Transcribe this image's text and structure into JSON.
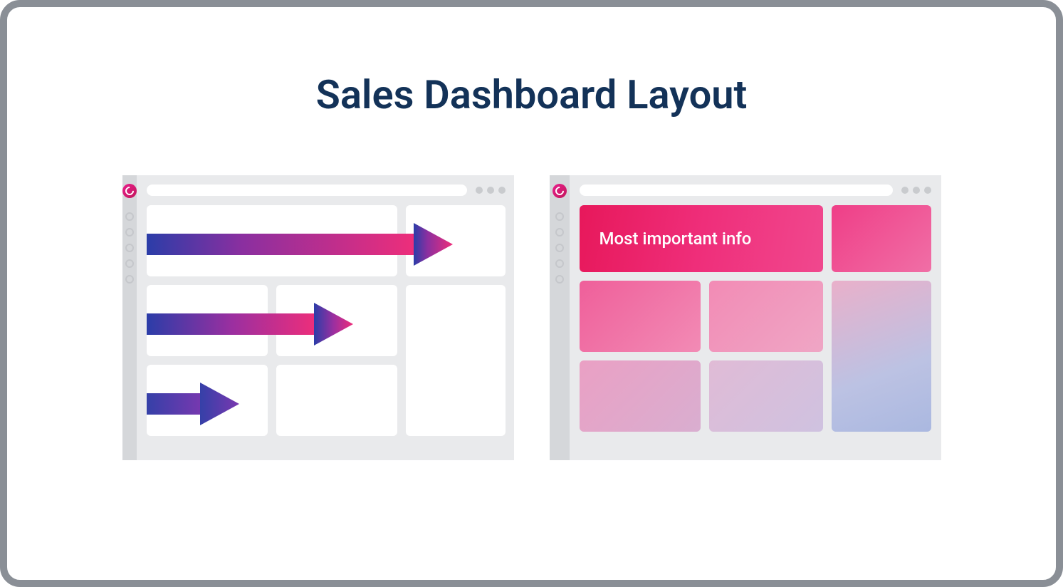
{
  "title": "Sales Dashboard Layout",
  "right_panel": {
    "hero_label": "Most important info"
  }
}
